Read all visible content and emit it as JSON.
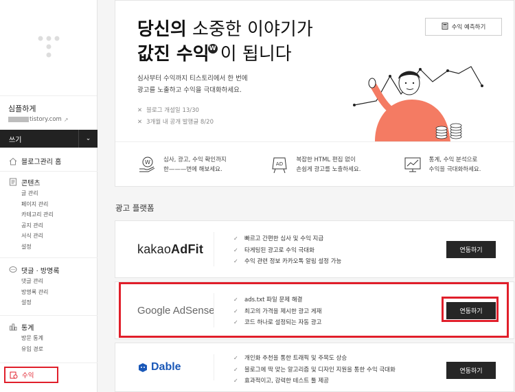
{
  "sidebar": {
    "blog_name": "심플하게",
    "blog_url_suffix": "tistory.com",
    "write_label": "쓰기",
    "home_label": "블로그관리 홈",
    "content": {
      "label": "콘텐츠",
      "items": [
        "글 관리",
        "페이지 관리",
        "카테고리 관리",
        "공지 관리",
        "서식 관리",
        "설정"
      ]
    },
    "comments": {
      "label": "댓글 · 방명록",
      "items": [
        "댓글 관리",
        "방명록 관리",
        "설정"
      ]
    },
    "stats": {
      "label": "통계",
      "items": [
        "방문 통계",
        "유입 경로"
      ]
    },
    "revenue_label": "수익"
  },
  "hero": {
    "title_line1_bold": "당신의",
    "title_line1_light": "소중한 이야기가",
    "title_line2_bold": "값진 수익",
    "badge": "W",
    "title_line2_light": "이 됩니다",
    "desc_line1": "심사부터 수익까지 티스토리에서 한 번에",
    "desc_line2": "광고를 노출하고 수익을 극대화하세요.",
    "note1": "블로그 개설일 13/30",
    "note2": "3개월 내 공개 발행글 8/20",
    "predict_button": "수익 예측하기"
  },
  "features": [
    {
      "icon": "hand-coin-icon",
      "line1": "심사, 광고, 수익 확인까지",
      "line2": "한———번에 해보세요."
    },
    {
      "icon": "ad-board-icon",
      "line1": "복잡한 HTML 편집 없이",
      "line2": "손쉽게 광고를 노출하세요."
    },
    {
      "icon": "chart-monitor-icon",
      "line1": "통계, 수익 분석으로",
      "line2": "수익을 극대화하세요."
    }
  ],
  "section_title": "광고 플랫폼",
  "platforms": [
    {
      "logo_light": "kakao",
      "logo_bold": "AdFit",
      "bullets": [
        "빠르고 간편한 심사 및 수익 지급",
        "타게팅된 광고로 수익 극대화",
        "수익 관련 정보 카카오톡 알림 설정 가능"
      ],
      "button": "연동하기"
    },
    {
      "logo": "Google AdSense",
      "bullets": [
        "ads.txt 파일 문제 해결",
        "최고의 가격을 제시한 광고 게재",
        "코드 하나로 설정되는 자동 광고"
      ],
      "button": "연동하기"
    },
    {
      "logo": "Dable",
      "bullets": [
        "개인화 추천을 통한 트래픽 및 주목도 상승",
        "블로그에 딱 맞는 알고리즘 및 디자인 지원을 통한 수익 극대화",
        "효과적이고, 강력한 테스트 툴 제공"
      ],
      "button": "연동하기"
    }
  ],
  "colors": {
    "highlight": "#e01e2a",
    "button": "#262626",
    "dable": "#1a58b8",
    "accent_peach": "#f47b63"
  }
}
